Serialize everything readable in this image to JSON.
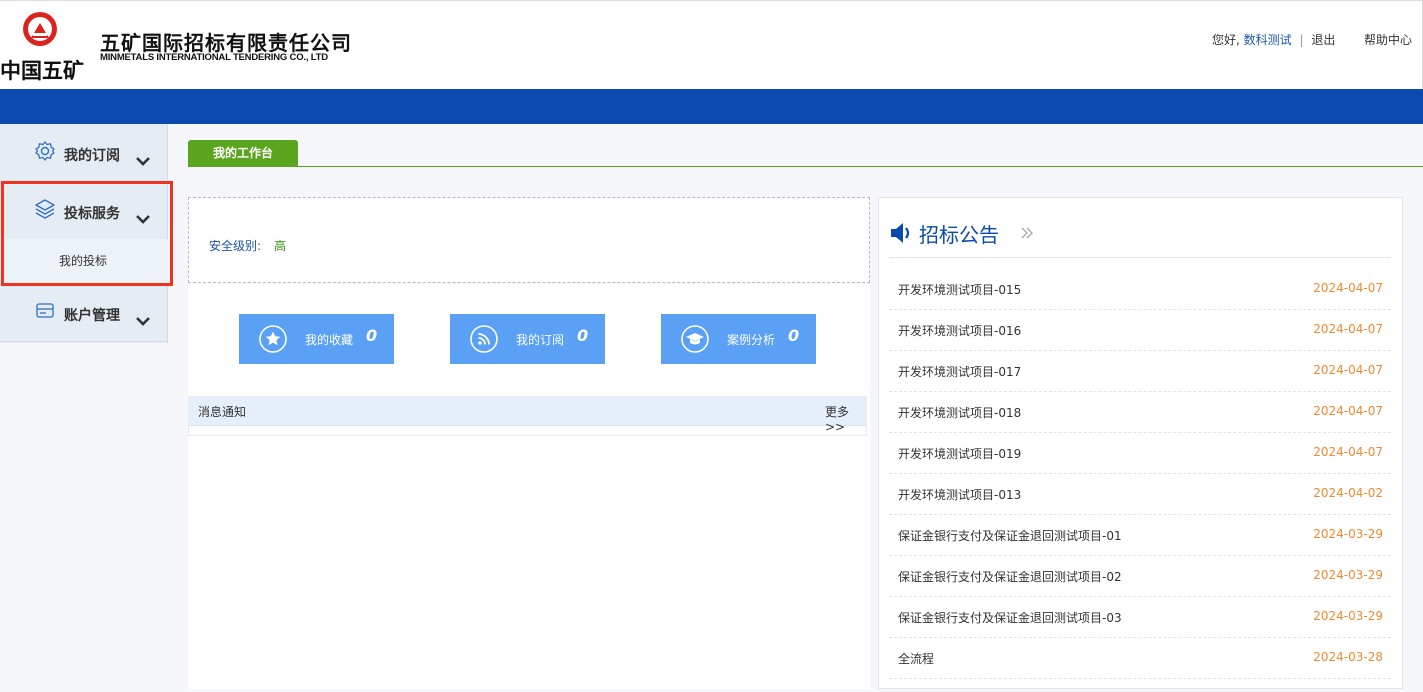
{
  "header": {
    "logo_cn": "中国五矿",
    "company_cn": "五矿国际招标有限责任公司",
    "company_en": "MINMETALS INTERNATIONAL TENDERING CO., LTD",
    "greeting": "您好,",
    "username": "数科测试",
    "logout": "退出",
    "help": "帮助中心"
  },
  "sidebar": {
    "groups": [
      {
        "label": "我的订阅",
        "icon": "gear-icon"
      },
      {
        "label": "投标服务",
        "icon": "layers-icon",
        "sub": [
          "我的投标"
        ]
      },
      {
        "label": "账户管理",
        "icon": "card-icon"
      }
    ]
  },
  "tab": {
    "label": "我的工作台"
  },
  "security": {
    "label": "安全级别:",
    "value": "高"
  },
  "quick_buttons": [
    {
      "label": "我的收藏",
      "count": "0",
      "icon": "star-icon"
    },
    {
      "label": "我的订阅",
      "count": "0",
      "icon": "rss-icon"
    },
    {
      "label": "案例分析",
      "count": "0",
      "icon": "graduation-cap-icon"
    }
  ],
  "messages": {
    "title": "消息通知",
    "more": "更多>>"
  },
  "announcements": {
    "title": "招标公告",
    "items": [
      {
        "name": "开发环境测试项目-015",
        "date": "2024-04-07"
      },
      {
        "name": "开发环境测试项目-016",
        "date": "2024-04-07"
      },
      {
        "name": "开发环境测试项目-017",
        "date": "2024-04-07"
      },
      {
        "name": "开发环境测试项目-018",
        "date": "2024-04-07"
      },
      {
        "name": "开发环境测试项目-019",
        "date": "2024-04-07"
      },
      {
        "name": "开发环境测试项目-013",
        "date": "2024-04-02"
      },
      {
        "name": "保证金银行支付及保证金退回测试项目-01",
        "date": "2024-03-29"
      },
      {
        "name": "保证金银行支付及保证金退回测试项目-02",
        "date": "2024-03-29"
      },
      {
        "name": "保证金银行支付及保证金退回测试项目-03",
        "date": "2024-03-29"
      },
      {
        "name": "全流程",
        "date": "2024-03-28"
      }
    ]
  },
  "colors": {
    "brand_blue": "#0a49ad",
    "tab_green": "#5aa51e",
    "button_blue": "#5aa0f4",
    "date_orange": "#f08a30",
    "highlight_red": "#f0321e"
  }
}
